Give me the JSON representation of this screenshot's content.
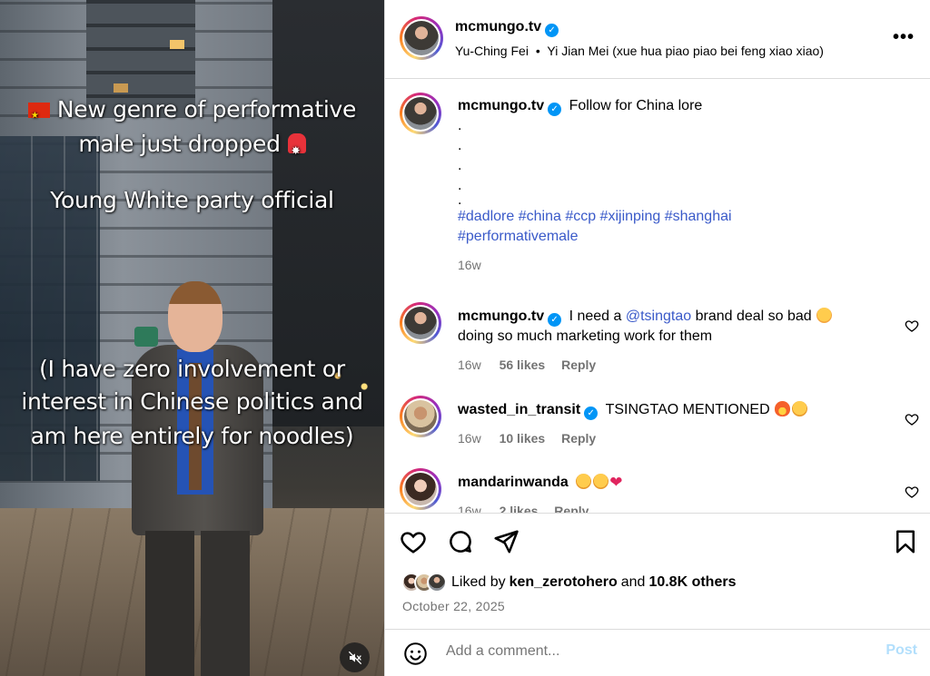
{
  "media": {
    "overlay_line1": "New genre of performative",
    "overlay_line2": "male just dropped",
    "overlay_line3": "Young White party official",
    "overlay_line4": "(I have zero involvement or",
    "overlay_line5": "interest in Chinese politics and",
    "overlay_line6": "am here entirely for noodles)",
    "mute_icon": "speaker-muted-icon"
  },
  "header": {
    "username": "mcmungo.tv",
    "audio_artist": "Yu-Ching Fei",
    "audio_separator": "•",
    "audio_title": "Yi Jian Mei (xue hua piao piao bei feng xiao xiao)",
    "more_label": "•••"
  },
  "caption": {
    "username": "mcmungo.tv",
    "text": "Follow for China lore",
    "dots": [
      ".",
      ".",
      ".",
      ".",
      "."
    ],
    "hashtags_line1": "#dadlore #china #ccp #xijinping #shanghai",
    "hashtags_line2": "#performativemale",
    "age": "16w"
  },
  "comments": [
    {
      "username": "mcmungo.tv",
      "text_before": "I need a ",
      "mention": "@tsingtao",
      "text_after": " brand deal so bad",
      "line2": "doing so much marketing work for them",
      "age": "16w",
      "likes": "56 likes",
      "reply": "Reply"
    },
    {
      "username": "wasted_in_transit",
      "text": "TSINGTAO MENTIONED",
      "age": "16w",
      "likes": "10 likes",
      "reply": "Reply"
    },
    {
      "username": "mandarinwanda",
      "text": "",
      "age": "16w",
      "likes": "2 likes",
      "reply": "Reply"
    }
  ],
  "actions": {
    "liked_by_prefix": "Liked by",
    "liked_by_user": "ken_zerotohero",
    "liked_by_and": "and",
    "liked_by_others": "10.8K others",
    "date": "October 22, 2025"
  },
  "comment_box": {
    "placeholder": "Add a comment...",
    "post_label": "Post"
  },
  "colors": {
    "verified": "#0095f6",
    "link": "#3a5ac9",
    "muted_text": "#737373",
    "post_disabled": "#b2dffc"
  }
}
